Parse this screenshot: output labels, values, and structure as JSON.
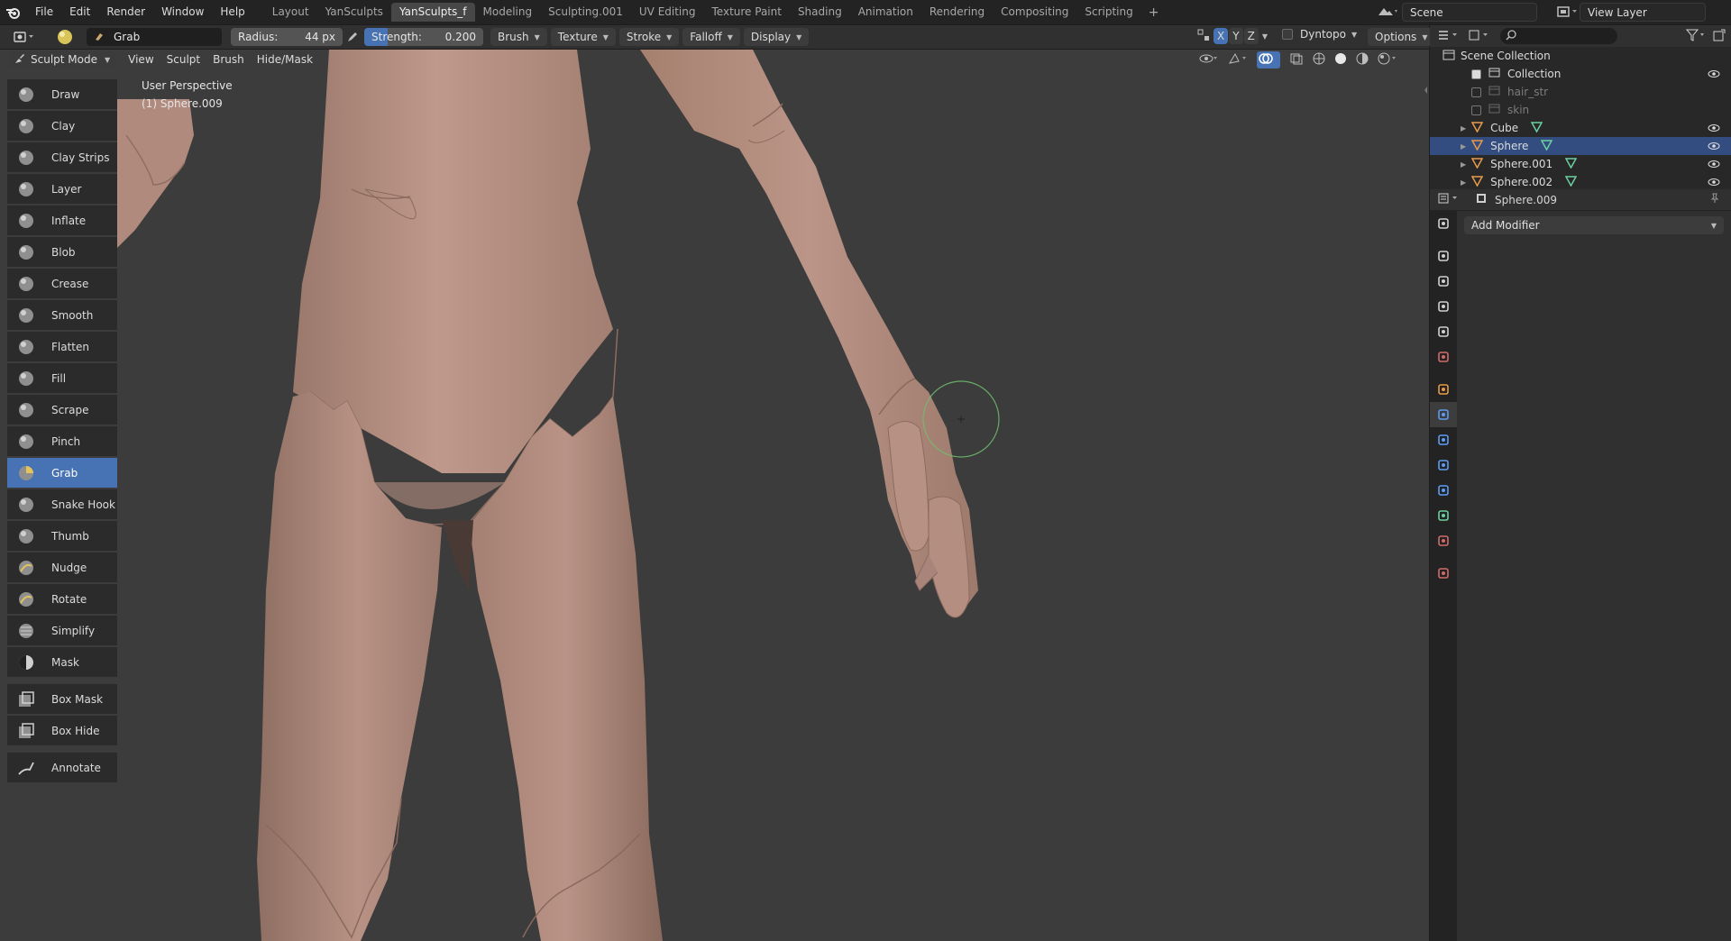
{
  "menu": {
    "items": [
      "File",
      "Edit",
      "Render",
      "Window",
      "Help"
    ]
  },
  "workspaces": {
    "tabs": [
      "Layout",
      "YanSculpts",
      "YanSculpts_f",
      "Modeling",
      "Sculpting.001",
      "UV Editing",
      "Texture Paint",
      "Shading",
      "Animation",
      "Rendering",
      "Compositing",
      "Scripting"
    ],
    "active": "YanSculpts_f",
    "add": "+"
  },
  "scene": {
    "name": "Scene",
    "view_layer": "View Layer"
  },
  "tool_header": {
    "brush_name": "Grab",
    "radius_label": "Radius:",
    "radius_value": "44 px",
    "strength_label": "Strength:",
    "strength_value": "0.200",
    "strength_fraction": 0.2,
    "dropdowns": [
      "Brush",
      "Texture",
      "Stroke",
      "Falloff",
      "Display"
    ],
    "dyntopo": "Dyntopo",
    "options": "Options",
    "axes": [
      "X",
      "Y",
      "Z"
    ]
  },
  "viewport_header": {
    "mode": "Sculpt Mode",
    "menus": [
      "View",
      "Sculpt",
      "Brush",
      "Hide/Mask"
    ]
  },
  "viewport_info": {
    "perspective": "User Perspective",
    "object": "(1) Sphere.009"
  },
  "toolbar": {
    "tools": [
      {
        "label": "Draw",
        "icon": "draw-brush-icon"
      },
      {
        "label": "Clay",
        "icon": "clay-brush-icon"
      },
      {
        "label": "Clay Strips",
        "icon": "clay-strips-brush-icon"
      },
      {
        "label": "Layer",
        "icon": "layer-brush-icon"
      },
      {
        "label": "Inflate",
        "icon": "inflate-brush-icon"
      },
      {
        "label": "Blob",
        "icon": "blob-brush-icon"
      },
      {
        "label": "Crease",
        "icon": "crease-brush-icon"
      },
      {
        "label": "Smooth",
        "icon": "smooth-brush-icon"
      },
      {
        "label": "Flatten",
        "icon": "flatten-brush-icon"
      },
      {
        "label": "Fill",
        "icon": "fill-brush-icon"
      },
      {
        "label": "Scrape",
        "icon": "scrape-brush-icon"
      },
      {
        "label": "Pinch",
        "icon": "pinch-brush-icon"
      },
      {
        "label": "Grab",
        "icon": "grab-brush-icon"
      },
      {
        "label": "Snake Hook",
        "icon": "snake-hook-brush-icon"
      },
      {
        "label": "Thumb",
        "icon": "thumb-brush-icon"
      },
      {
        "label": "Nudge",
        "icon": "nudge-brush-icon"
      },
      {
        "label": "Rotate",
        "icon": "rotate-brush-icon"
      },
      {
        "label": "Simplify",
        "icon": "simplify-brush-icon"
      },
      {
        "label": "Mask",
        "icon": "mask-brush-icon"
      }
    ],
    "active": "Grab",
    "extra_tools": [
      {
        "label": "Box Mask",
        "icon": "box-mask-icon"
      },
      {
        "label": "Box Hide",
        "icon": "box-hide-icon"
      }
    ],
    "annotate": {
      "label": "Annotate",
      "icon": "annotate-icon"
    }
  },
  "outliner": {
    "root": "Scene Collection",
    "rows": [
      {
        "name": "Collection",
        "type": "collection",
        "checked": true,
        "visible": true
      },
      {
        "name": "hair_str",
        "type": "collection",
        "checked": false,
        "visible": false
      },
      {
        "name": "skin",
        "type": "collection",
        "checked": false,
        "visible": false
      },
      {
        "name": "Cube",
        "type": "mesh",
        "visible": true
      },
      {
        "name": "Sphere",
        "type": "mesh",
        "visible": true,
        "selected": true
      },
      {
        "name": "Sphere.001",
        "type": "mesh",
        "visible": true
      },
      {
        "name": "Sphere.002",
        "type": "mesh",
        "visible": true
      }
    ]
  },
  "properties": {
    "object": "Sphere.009",
    "add_modifier": "Add Modifier",
    "tabs": [
      "tool-icon",
      "render-icon",
      "output-icon",
      "view-layer-icon",
      "scene-icon",
      "world-icon",
      "object-icon",
      "modifier-icon",
      "particles-icon",
      "physics-icon",
      "constraints-icon",
      "data-icon",
      "material-icon",
      "texture-icon"
    ],
    "active_tab": "modifier-icon"
  },
  "colors": {
    "accent": "#4772b3",
    "skin": "#b08a7c",
    "viewport_bg": "#3c3c3c"
  }
}
